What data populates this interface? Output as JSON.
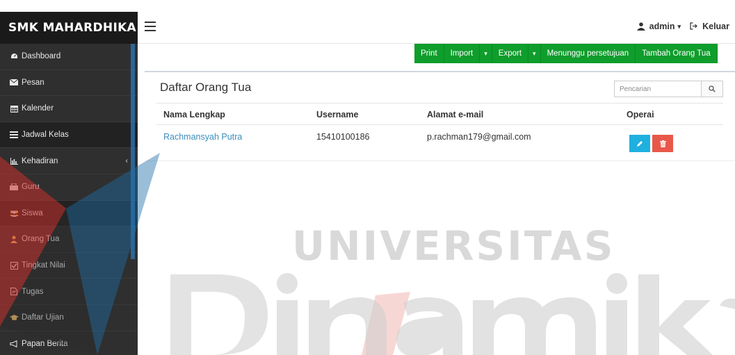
{
  "brand": "SMK MAHARDHIKA",
  "sidebar": {
    "items": [
      {
        "label": "Dashboard",
        "icon": "dashboard-icon"
      },
      {
        "label": "Pesan",
        "icon": "envelope-icon"
      },
      {
        "label": "Kalender",
        "icon": "calendar-icon"
      },
      {
        "label": "Jadwal Kelas",
        "icon": "list-icon"
      },
      {
        "label": "Kehadiran",
        "icon": "bar-chart-icon"
      },
      {
        "label": "Guru",
        "icon": "teacher-icon"
      },
      {
        "label": "Siswa",
        "icon": "users-icon"
      },
      {
        "label": "Orang Tua",
        "icon": "user-icon"
      },
      {
        "label": "Tingkat Nilai",
        "icon": "checkbox-icon"
      },
      {
        "label": "Tugas",
        "icon": "file-icon"
      },
      {
        "label": "Daftar Ujian",
        "icon": "graduation-cap-icon"
      },
      {
        "label": "Papan Berita",
        "icon": "bullhorn-icon"
      }
    ],
    "expand_chevron": "‹"
  },
  "header": {
    "user_label": "admin",
    "logout_label": "Keluar"
  },
  "toolbar": {
    "print": "Print",
    "import": "Import",
    "export": "Export",
    "pending": "Menunggu persetujuan",
    "add_parent": "Tambah Orang Tua"
  },
  "panel": {
    "title": "Daftar Orang Tua",
    "search_placeholder": "Pencarian",
    "columns": [
      "Nama Lengkap",
      "Username",
      "Alamat e-mail",
      "Operai"
    ],
    "rows": [
      {
        "name": "Rachmansyah Putra",
        "username": "15410100186",
        "email": "p.rachman179@gmail.com"
      }
    ]
  },
  "watermark": {
    "text": "UNIVERSITAS",
    "script_text": "Dinamika"
  },
  "colors": {
    "sidebar_bg": "#2f2f2f",
    "toolbar_green": "#0f9d2c",
    "edit_blue": "#1fb0e0",
    "delete_red": "#e8584a",
    "link_blue": "#3c8dbc"
  }
}
